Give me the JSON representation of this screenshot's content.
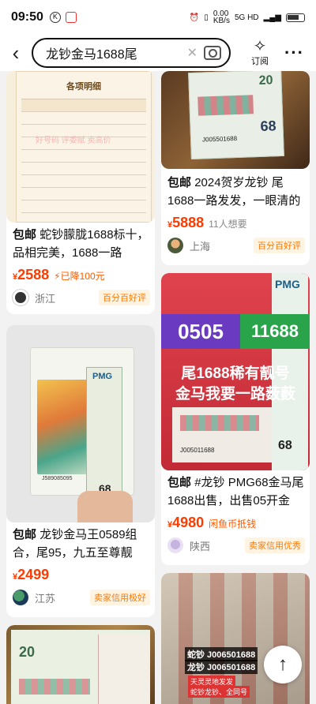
{
  "status_bar": {
    "time": "09:50",
    "net_speed": "0.00\nKB/s",
    "signal": "5G HD"
  },
  "header": {
    "search_text": "龙钞金马1688尾",
    "subscribe_label": "订阅"
  },
  "cards": [
    {
      "baoyou": "包邮",
      "title": "蛇钞朦胧1688标十，品相完美，1688一路",
      "price": "2588",
      "price_note": "⚡已降100元",
      "city": "浙江",
      "badge": "百分百好评",
      "image_text": {
        "header": "各项明细",
        "watermark": "好号码 评委赋 卖高价"
      }
    },
    {
      "baoyou": "包邮",
      "title": "2024贺岁龙钞 尾1688一路发发，一眼清的",
      "price": "5888",
      "price_note": "11人想要",
      "city": "上海",
      "badge": "百分百好评",
      "image_text": {
        "serial": "J005501688"
      }
    },
    {
      "baoyou": "包邮",
      "title": "龙钞金马王0589组合，尾95，九五至尊靓",
      "price": "2499",
      "price_note": "",
      "city": "江苏",
      "badge": "卖家信用极好",
      "image_text": {
        "serial": "J589085095"
      }
    },
    {
      "baoyou": "包邮",
      "title": "#龙钞 PMG68金马尾1688出售，出售05开金",
      "price": "4980",
      "price_note": "闲鱼币抵钱",
      "city": "陕西",
      "badge": "卖家信用优秀",
      "image_text": {
        "prefix": "0505",
        "suffix": "11688",
        "line1": "尾1688稀有靓号",
        "line2": "金马我要一路薮薮",
        "serial": "J005011688"
      }
    },
    {
      "image_text": {
        "line1": "蛇钞 J006501688",
        "line2": "龙钞 J006501688",
        "line3": "天灵灵地发发",
        "line4": "蛇钞龙钞、全同号"
      }
    }
  ]
}
